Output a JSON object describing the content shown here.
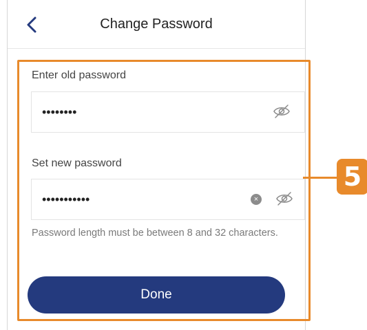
{
  "header": {
    "title": "Change Password",
    "back_icon": "chevron-left-icon"
  },
  "old_password": {
    "label": "Enter old password",
    "value": "••••••••",
    "visibility_icon": "eye-off-icon"
  },
  "new_password": {
    "label": "Set new password",
    "value": "•••••••••••",
    "clear_icon": "clear-icon",
    "clear_glyph": "×",
    "visibility_icon": "eye-off-icon",
    "hint": "Password length must be between 8 and 32 characters."
  },
  "actions": {
    "done_label": "Done"
  },
  "annotation": {
    "step_number": "5"
  },
  "colors": {
    "accent": "#e88a2b",
    "primary_button": "#243a7e",
    "back_arrow": "#243a7e"
  }
}
